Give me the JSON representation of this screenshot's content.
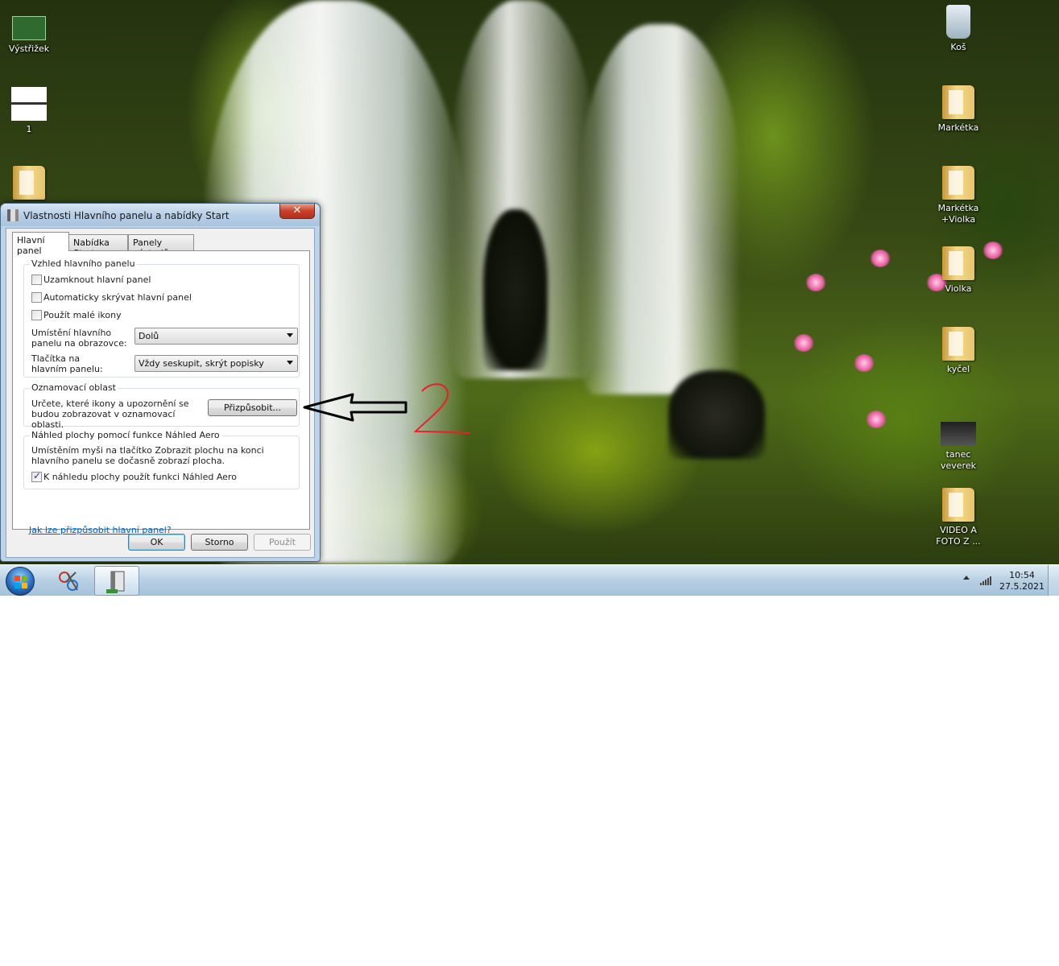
{
  "desktop": {
    "icons_left": [
      {
        "label": "Výstřižek"
      },
      {
        "label": "1"
      },
      {
        "label": ""
      }
    ],
    "icons_right": [
      {
        "label": "Koš"
      },
      {
        "label": "Markétka"
      },
      {
        "label": "Markétka +Violka"
      },
      {
        "label": "Violka"
      },
      {
        "label": "kyčel"
      },
      {
        "label": "tanec veverek"
      },
      {
        "label": "VIDEO A FOTO Z ..."
      }
    ]
  },
  "dialog": {
    "title": "Vlastnosti Hlavního panelu a nabídky Start",
    "close_label": "✕",
    "tabs": [
      {
        "label": "Hlavní panel",
        "active": true
      },
      {
        "label": "Nabídka Start",
        "active": false
      },
      {
        "label": "Panely nástrojů",
        "active": false
      }
    ],
    "appearance": {
      "title": "Vzhled hlavního panelu",
      "lock": {
        "label": "Uzamknout hlavní panel",
        "checked": false
      },
      "autohide": {
        "label": "Automaticky skrývat hlavní panel",
        "checked": false
      },
      "small_icons": {
        "label": "Použít malé ikony",
        "checked": false
      },
      "location_label": "Umístění hlavního panelu na obrazovce:",
      "location_value": "Dolů",
      "buttons_label": "Tlačítka na hlavním panelu:",
      "buttons_value": "Vždy seskupit, skrýt popisky"
    },
    "notification": {
      "title": "Oznamovací oblast",
      "text": "Určete, které ikony a upozornění se budou zobrazovat v oznamovací oblasti.",
      "customize_label": "Přizpůsobit..."
    },
    "aero_peek": {
      "title": "Náhled plochy pomocí funkce Náhled Aero",
      "text": "Umístěním myši na tlačítko Zobrazit plochu na konci hlavního panelu se dočasně zobrazí plocha.",
      "checkbox_label": "K náhledu plochy použít funkci Náhled Aero",
      "checked": true
    },
    "help_link": "Jak lze přizpůsobit hlavní panel?",
    "ok_label": "OK",
    "cancel_label": "Storno",
    "apply_label": "Použít"
  },
  "annotation": {
    "number": "2",
    "color": "#e8202a"
  },
  "taskbar": {
    "time": "10:54",
    "date": "27.5.2021"
  }
}
